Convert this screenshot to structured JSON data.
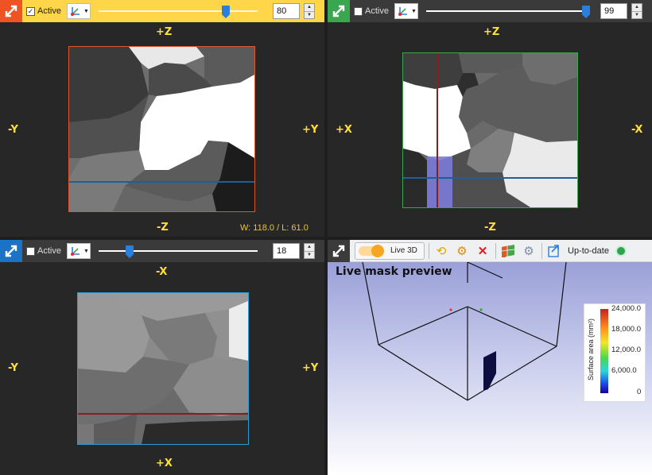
{
  "panels": {
    "top_left": {
      "active_label": "Active",
      "active_checked": true,
      "slider_percent": 80,
      "slice_value": "80",
      "axes": {
        "top": "+Z",
        "bottom": "-Z",
        "left": "-Y",
        "right": "+Y"
      },
      "window_level": "W: 118.0 / L: 61.0",
      "accent": "#ef5323"
    },
    "top_right": {
      "active_label": "Active",
      "active_checked": false,
      "slider_percent": 99,
      "slice_value": "99",
      "axes": {
        "top": "+Z",
        "bottom": "-Z",
        "left": "+X",
        "right": "-X"
      },
      "accent": "#3aa650"
    },
    "bottom_left": {
      "active_label": "Active",
      "active_checked": false,
      "slider_percent": 18,
      "slice_value": "18",
      "axes": {
        "top": "-X",
        "bottom": "+X",
        "left": "-Y",
        "right": "+Y"
      },
      "accent": "#1a73c4"
    },
    "bottom_right": {
      "live_toggle_label": "Live 3D",
      "status_text": "Up-to-date",
      "status_color": "#2ea44f",
      "title": "Live mask preview",
      "legend": {
        "title": "Surface area (mm²)",
        "ticks": [
          "24,000.0",
          "18,000.0",
          "12,000.0",
          "6,000.0",
          "0"
        ]
      }
    }
  },
  "icons": {
    "maximize": "maximize-arrows-icon",
    "axis_selector": "axis-orientation-icon",
    "refresh": "refresh-icon",
    "settings": "settings-icon",
    "delete": "delete-x-icon",
    "mesh": "mesh-icon",
    "export": "export-icon"
  }
}
